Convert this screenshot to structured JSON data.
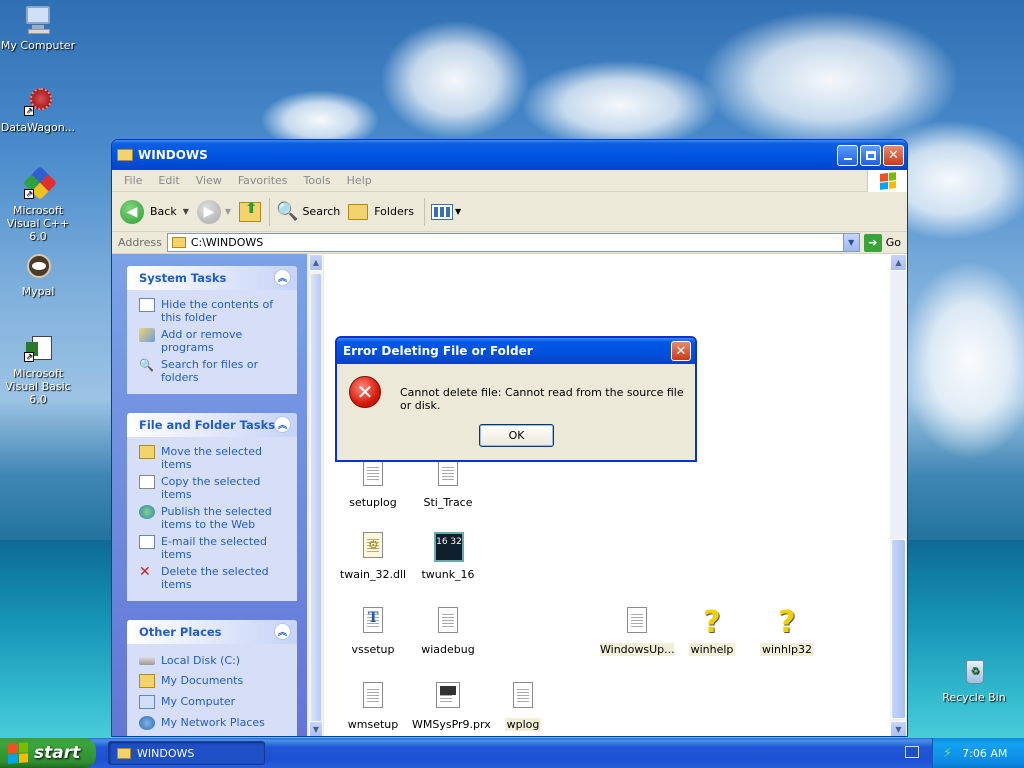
{
  "desktop": {
    "icons": [
      {
        "label": "My Computer"
      },
      {
        "label": "DataWagon..."
      },
      {
        "label": "Microsoft Visual C++ 6.0"
      },
      {
        "label": "Mypal"
      },
      {
        "label": "Microsoft Visual Basic 6.0"
      },
      {
        "label": "Recycle Bin"
      }
    ]
  },
  "window": {
    "title": "WINDOWS",
    "menu": [
      "File",
      "Edit",
      "View",
      "Favorites",
      "Tools",
      "Help"
    ],
    "toolbar": {
      "back": "Back",
      "search": "Search",
      "folders": "Folders"
    },
    "address": {
      "label": "Address",
      "value": "C:\\WINDOWS",
      "go": "Go"
    },
    "panels": {
      "system_tasks": {
        "title": "System Tasks",
        "items": [
          "Hide the contents of this folder",
          "Add or remove programs",
          "Search for files or folders"
        ]
      },
      "file_folder_tasks": {
        "title": "File and Folder Tasks",
        "items": [
          "Move the selected items",
          "Copy the selected items",
          "Publish the selected items to the Web",
          "E-mail the selected items",
          "Delete the selected items"
        ]
      },
      "other_places": {
        "title": "Other Places",
        "items": [
          "Local Disk (C:)",
          "My Documents",
          "My Computer",
          "My Network Places"
        ]
      }
    },
    "files": [
      {
        "name": "setuplog"
      },
      {
        "name": "Sti_Trace"
      },
      {
        "name": "twain_32.dll"
      },
      {
        "name": "twunk_16",
        "badge": "16 32"
      },
      {
        "name": "vssetup"
      },
      {
        "name": "wiadebug"
      },
      {
        "name": "WindowsUp..."
      },
      {
        "name": "winhelp"
      },
      {
        "name": "winhlp32"
      },
      {
        "name": "wmsetup"
      },
      {
        "name": "WMSysPr9.prx"
      },
      {
        "name": "wplog"
      }
    ]
  },
  "dialog": {
    "title": "Error Deleting File or Folder",
    "message": "Cannot delete file: Cannot read from the source file or disk.",
    "ok": "OK"
  },
  "taskbar": {
    "start": "start",
    "task": "WINDOWS",
    "clock": "7:06 AM"
  }
}
